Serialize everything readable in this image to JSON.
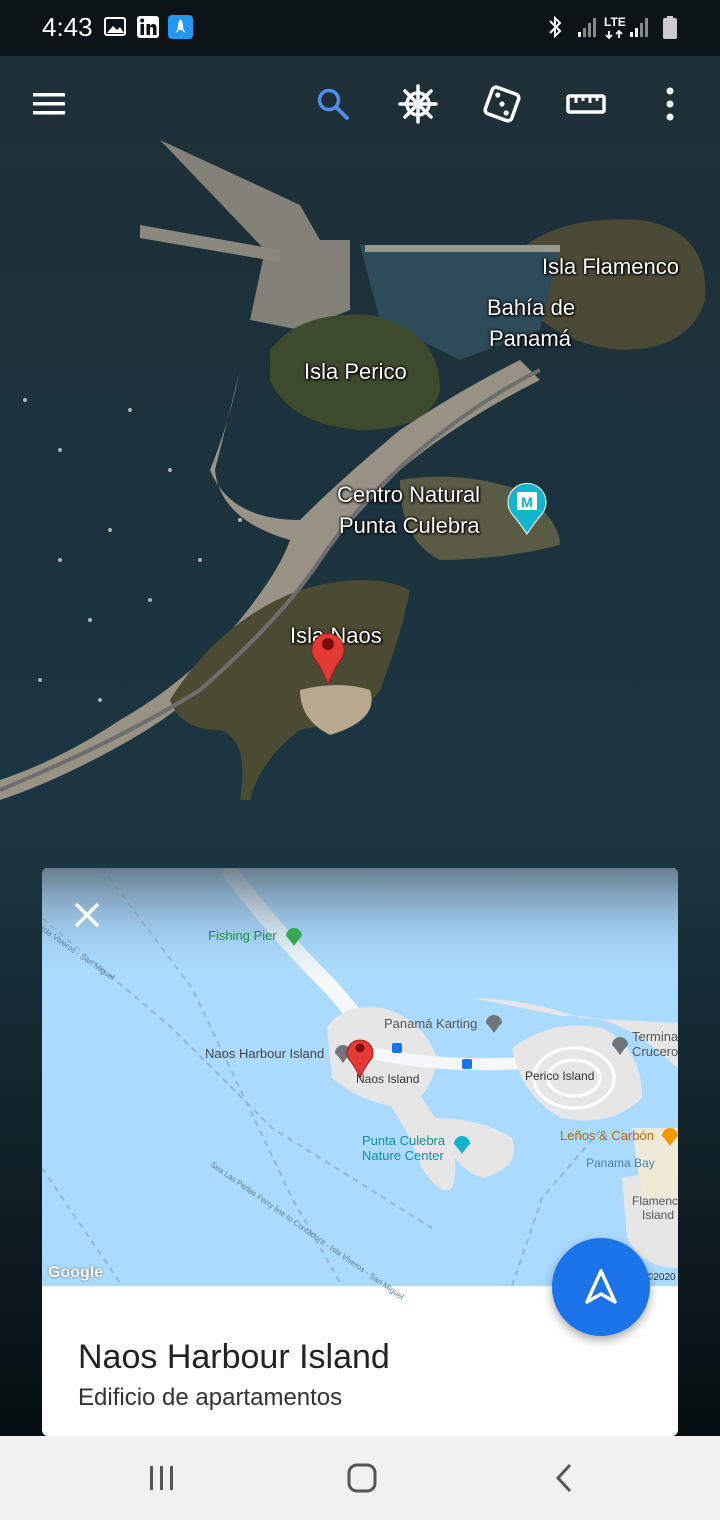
{
  "status_bar": {
    "time": "4:43",
    "network": "LTE"
  },
  "toolbar": {
    "menu_icon": "hamburger-menu-icon",
    "search_icon": "search-icon",
    "voyager_icon": "ship-wheel-icon",
    "feeling_lucky_icon": "dice-icon",
    "measure_icon": "ruler-icon",
    "more_icon": "more-vert-icon",
    "accent": "#1a73e8"
  },
  "map_labels": {
    "isla_flamenco": "Isla Flamenco",
    "bahia_line1": "Bahía de",
    "bahia_line2": "Panamá",
    "isla_perico": "Isla Perico",
    "centro_line1": "Centro Natural",
    "centro_line2": "Punta Culebra",
    "isla_naos": "Isla Naos"
  },
  "card": {
    "close_icon": "close-icon",
    "title": "Naos Harbour Island",
    "subtitle": "Edificio de apartamentos",
    "minimap": {
      "fishing_pier": "Fishing Pier",
      "panama_karting": "Panamá Karting",
      "naos_harbour_island": "Naos Harbour Island",
      "naos_island": "Naos Island",
      "perico_island": "Perico Island",
      "terminal_line1": "Termina",
      "terminal_line2": "Crucero",
      "punta_culebra_line1": "Punta Culebra",
      "punta_culebra_line2": "Nature Center",
      "lenos": "Leños & Carbón",
      "panama_bay": "Panama Bay",
      "flamenco_line1": "Flamenc",
      "flamenco_line2": "Island",
      "ferry_line": "Sea Las Perlas Ferry line to Contadora - Isla Viveros - San Miguel",
      "route_label": "Isla Viveros - San Miguel",
      "google_logo": "Google",
      "copyright": "©2020"
    },
    "navigate_icon": "navigation-arrow-icon"
  },
  "nav_bar": {
    "recents_icon": "recents-icon",
    "home_icon": "home-icon",
    "back_icon": "back-icon"
  }
}
